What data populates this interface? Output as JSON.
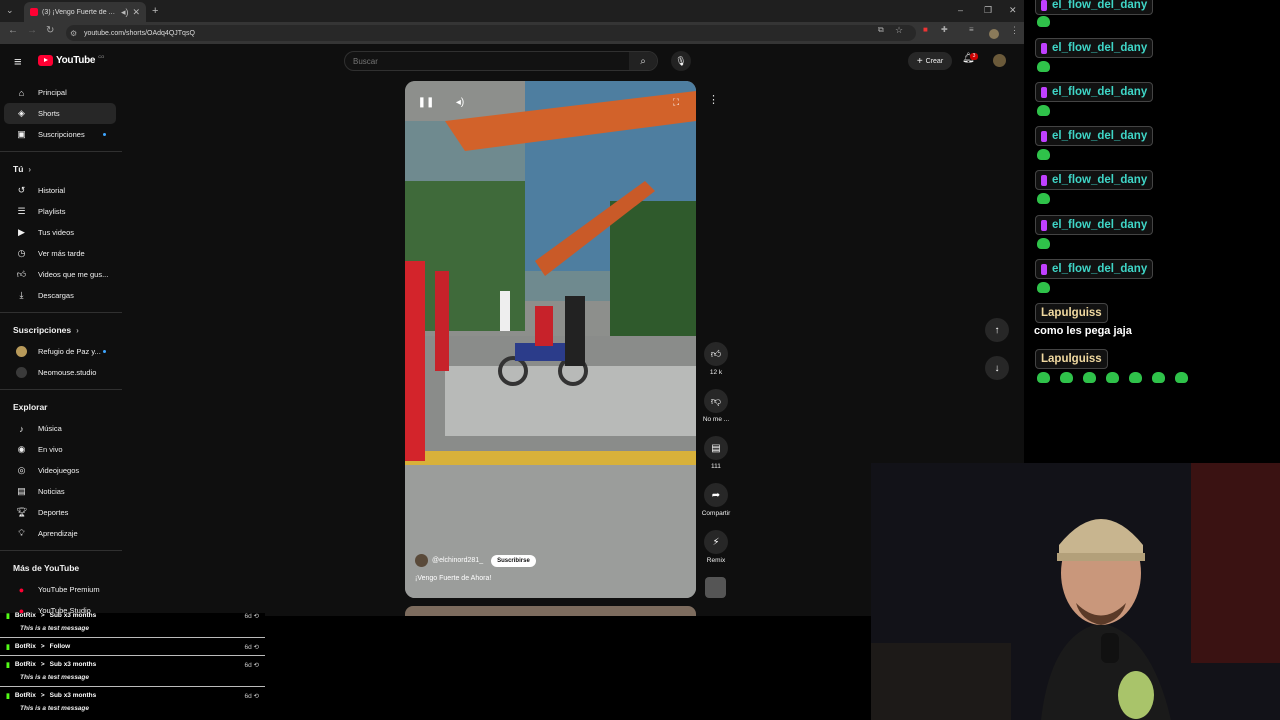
{
  "browser": {
    "tab_title": "(3) ¡Vengo Fuerte de Ahora!",
    "new_tab": "+",
    "url": "youtube.com/shorts/OAdq4QJTqsQ"
  },
  "masthead": {
    "logo_text": "YouTube",
    "country_code": "CO",
    "search_placeholder": "Buscar",
    "create_label": "Crear",
    "notification_count": "3"
  },
  "sidebar": {
    "main": [
      {
        "label": "Principal",
        "icon": "home-icon"
      },
      {
        "label": "Shorts",
        "icon": "shorts-icon"
      },
      {
        "label": "Suscripciones",
        "icon": "subscriptions-icon"
      }
    ],
    "you_heading": "Tú",
    "you_items": [
      {
        "label": "Historial",
        "icon": "history-icon"
      },
      {
        "label": "Playlists",
        "icon": "playlists-icon"
      },
      {
        "label": "Tus videos",
        "icon": "your-videos-icon"
      },
      {
        "label": "Ver más tarde",
        "icon": "watch-later-icon"
      },
      {
        "label": "Videos que me gus...",
        "icon": "liked-videos-icon"
      },
      {
        "label": "Descargas",
        "icon": "downloads-icon"
      }
    ],
    "subs_heading": "Suscripciones",
    "subs_items": [
      {
        "label": "Refugio de Paz y...",
        "color": "#b89a5a"
      },
      {
        "label": "Neomouse.studio",
        "color": "#3a3a3a"
      }
    ],
    "explore_heading": "Explorar",
    "explore_items": [
      {
        "label": "Música",
        "icon": "music-icon"
      },
      {
        "label": "En vivo",
        "icon": "live-icon"
      },
      {
        "label": "Videojuegos",
        "icon": "gaming-icon"
      },
      {
        "label": "Noticias",
        "icon": "news-icon"
      },
      {
        "label": "Deportes",
        "icon": "sports-icon"
      },
      {
        "label": "Aprendizaje",
        "icon": "learning-icon"
      }
    ],
    "more_heading": "Más de YouTube",
    "more_items": [
      {
        "label": "YouTube Premium",
        "icon": "youtube-premium-icon"
      },
      {
        "label": "YouTube Studio",
        "icon": "youtube-studio-icon"
      }
    ]
  },
  "short": {
    "channel": "@elchinord281_",
    "subscribe_label": "Suscribirse",
    "title": "¡Vengo Fuerte de Ahora!",
    "actions": {
      "likes": "12 k",
      "dislike": "No me ...",
      "comments": "111",
      "share": "Compartir",
      "remix": "Remix"
    }
  },
  "alerts": [
    {
      "user": "BotRix",
      "event": "Sub x3 months",
      "time": "6d",
      "message": "This is a test message"
    },
    {
      "user": "BotRix",
      "event": "Follow",
      "time": "6d",
      "message": ""
    },
    {
      "user": "BotRix",
      "event": "Sub x3 months",
      "time": "6d",
      "message": "This is a test message"
    },
    {
      "user": "BotRix",
      "event": "Sub x3 months",
      "time": "6d",
      "message": "This is a test message"
    }
  ],
  "chat": {
    "messages": [
      {
        "user": "el_flow_del_dany",
        "color": "#3fd6c7"
      },
      {
        "user": "el_flow_del_dany",
        "color": "#3fd6c7"
      },
      {
        "user": "el_flow_del_dany",
        "color": "#3fd6c7"
      },
      {
        "user": "el_flow_del_dany",
        "color": "#3fd6c7"
      },
      {
        "user": "el_flow_del_dany",
        "color": "#3fd6c7"
      },
      {
        "user": "el_flow_del_dany",
        "color": "#3fd6c7"
      },
      {
        "user": "el_flow_del_dany",
        "color": "#3fd6c7"
      },
      {
        "user": "Lapulguiss",
        "color": "#f0d9a0",
        "text": "como les pega jaja"
      },
      {
        "user": "Lapulguiss",
        "color": "#f0d9a0"
      }
    ]
  },
  "colors": {
    "yt_bg": "#0f0f0f",
    "yt_red": "#ff0033",
    "accent_blue": "#3ea6ff",
    "emote_green": "#2fc24a"
  }
}
